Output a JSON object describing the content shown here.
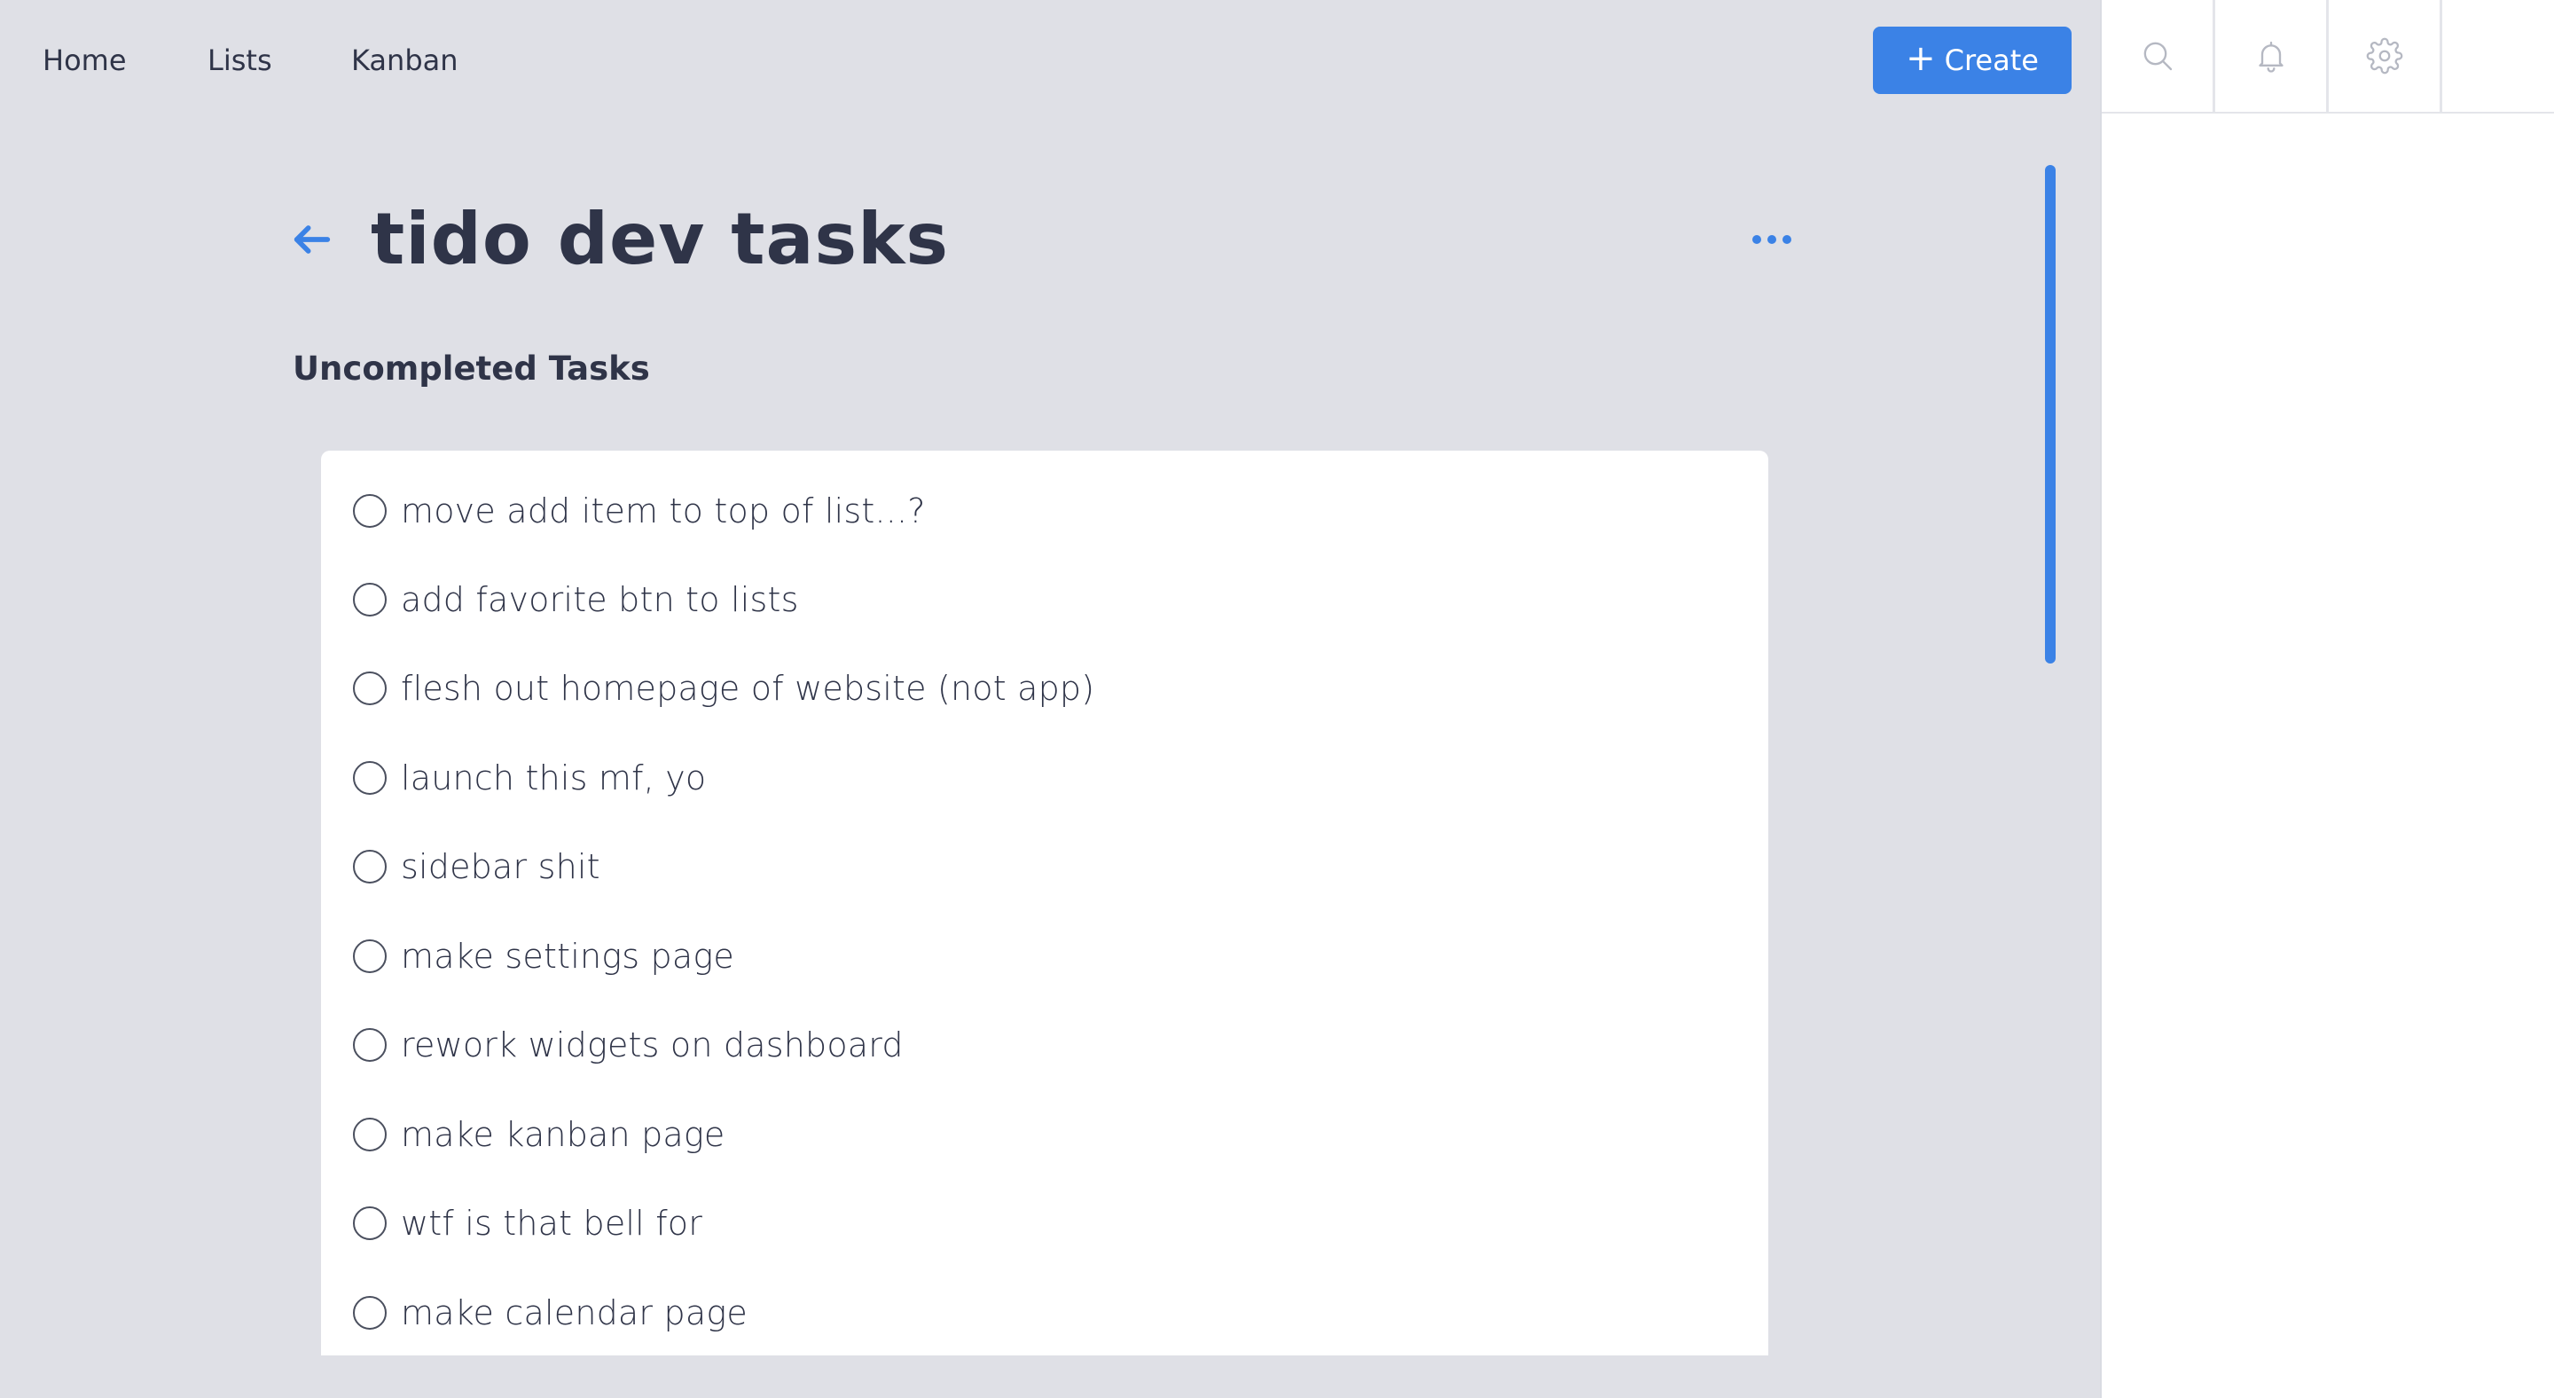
{
  "nav": {
    "links": [
      "Home",
      "Lists",
      "Kanban"
    ],
    "create_label": "Create"
  },
  "toolbar_icons": [
    "search-icon",
    "bell-icon",
    "gear-icon"
  ],
  "list": {
    "title": "tido dev tasks",
    "section_title": "Uncompleted Tasks",
    "tasks": [
      "move add item to top of list...?",
      "add favorite btn to lists",
      "flesh out homepage of website (not app)",
      "launch this mf, yo",
      "sidebar shit",
      "make settings page",
      "rework widgets on dashboard",
      "make kanban page",
      "wtf is that bell for",
      "make calendar page"
    ]
  },
  "colors": {
    "accent": "#3b82e6",
    "background": "#dfe0e6",
    "text": "#2f3448",
    "panel": "#ffffff"
  }
}
